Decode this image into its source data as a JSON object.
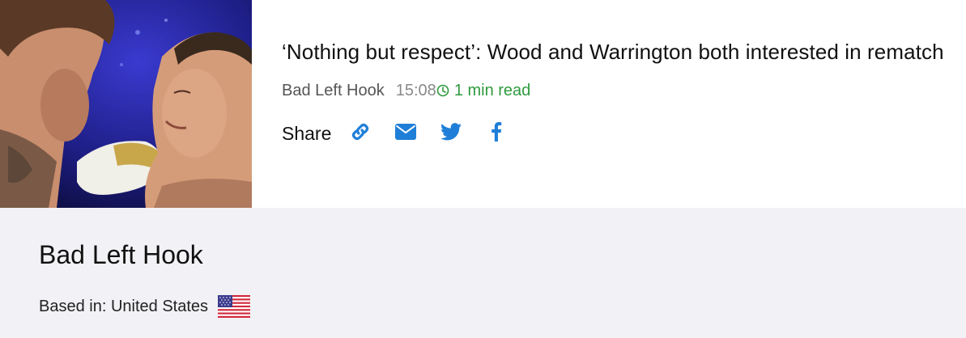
{
  "article": {
    "headline": "‘Nothing but respect’: Wood and Warrington both interested in rematch",
    "source": "Bad Left Hook",
    "time": "15:08",
    "read_time": "1 min read",
    "share_label": "Share",
    "share_buttons": [
      {
        "icon": "link-icon"
      },
      {
        "icon": "email-icon"
      },
      {
        "icon": "twitter-icon"
      },
      {
        "icon": "facebook-icon"
      }
    ],
    "thumbnail": {
      "icon": "boxing-photo"
    }
  },
  "publisher": {
    "name": "Bad Left Hook",
    "based_in_label": "Based in: United States",
    "flag_icon": "us-flag-icon"
  },
  "colors": {
    "accent_blue": "#1f7fd8",
    "read_time_green": "#2e9a3e",
    "footer_bg": "#f2f1f5"
  }
}
